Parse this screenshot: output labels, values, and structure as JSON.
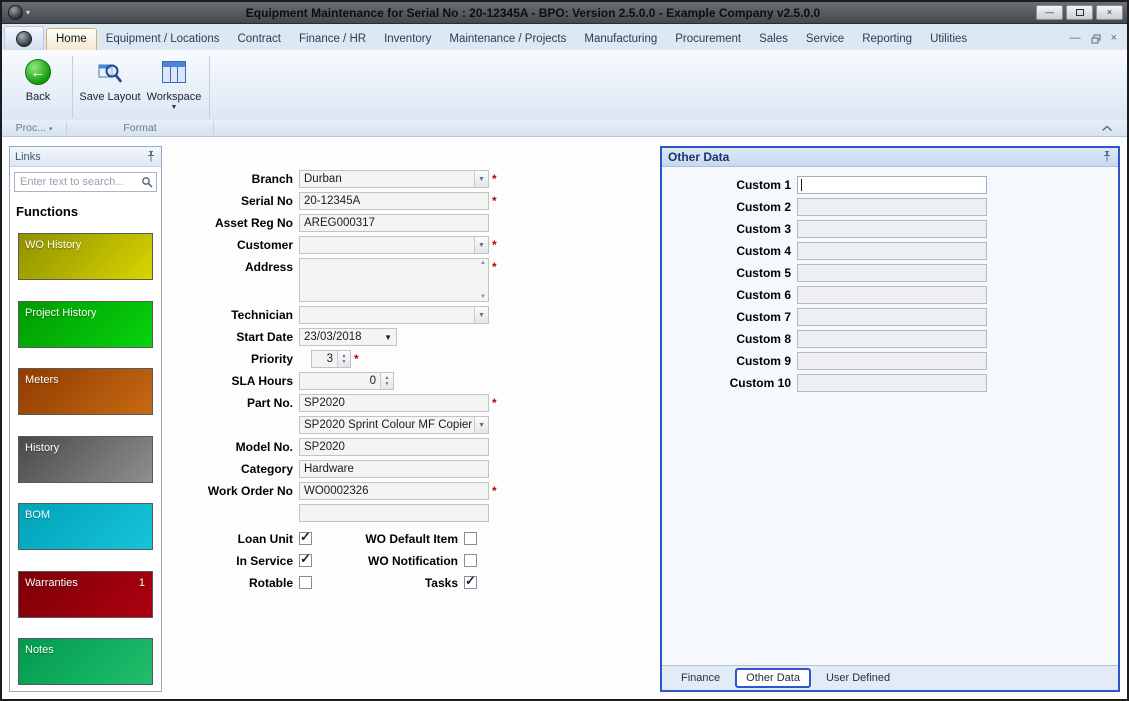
{
  "accent": {
    "highlight_blue": "#2f55c8",
    "required_red": "#c00000"
  },
  "icons": {
    "chevron_down": "▼",
    "chevron_up": "▲",
    "small_caret": "▾",
    "minimize": "—",
    "close": "×",
    "back_arrow": "←"
  },
  "titlebar": {
    "title": "Equipment Maintenance for Serial No : 20-12345A - BPO: Version 2.5.0.0 - Example Company v2.5.0.0"
  },
  "ribbon": {
    "tabs": [
      {
        "label": "Home"
      },
      {
        "label": "Equipment / Locations"
      },
      {
        "label": "Contract"
      },
      {
        "label": "Finance / HR"
      },
      {
        "label": "Inventory"
      },
      {
        "label": "Maintenance / Projects"
      },
      {
        "label": "Manufacturing"
      },
      {
        "label": "Procurement"
      },
      {
        "label": "Sales"
      },
      {
        "label": "Service"
      },
      {
        "label": "Reporting"
      },
      {
        "label": "Utilities"
      }
    ],
    "back_label": "Back",
    "save_layout_label": "Save Layout",
    "workspace_label": "Workspace",
    "group_process": "Proc...",
    "group_format": "Format"
  },
  "links_panel": {
    "title": "Links",
    "search_placeholder": "Enter text to search...",
    "heading": "Functions",
    "tiles": [
      {
        "label": "WO History",
        "color1": "#8f9000",
        "color2": "#d9d500",
        "badge": ""
      },
      {
        "label": "Project History",
        "color1": "#009b00",
        "color2": "#06d40e",
        "badge": ""
      },
      {
        "label": "Meters",
        "color1": "#8f3c00",
        "color2": "#c86a14",
        "badge": ""
      },
      {
        "label": "History",
        "color1": "#4a4a4a",
        "color2": "#8f8f8f",
        "badge": ""
      },
      {
        "label": "BOM",
        "color1": "#00a2ba",
        "color2": "#17c4d8",
        "badge": ""
      },
      {
        "label": "Warranties",
        "color1": "#7c0006",
        "color2": "#ae0010",
        "badge": "1"
      },
      {
        "label": "Notes",
        "color1": "#009a4e",
        "color2": "#22bf6e",
        "badge": ""
      }
    ]
  },
  "form": {
    "required_marker": "*",
    "rows": [
      {
        "label": "Branch",
        "value": "Durban"
      },
      {
        "label": "Serial No",
        "value": "20-12345A"
      },
      {
        "label": "Asset Reg No",
        "value": "AREG000317"
      },
      {
        "label": "Customer",
        "value": ""
      },
      {
        "label": "Address",
        "value": ""
      },
      {
        "label": "Technician",
        "value": ""
      },
      {
        "label": "Start Date",
        "value": "23/03/2018"
      },
      {
        "label": "Priority",
        "value": "3"
      },
      {
        "label": "SLA Hours",
        "value": "0"
      },
      {
        "label": "Part No.",
        "value": "SP2020"
      },
      {
        "label": "",
        "value": "SP2020 Sprint Colour MF Copier"
      },
      {
        "label": "Model No.",
        "value": "SP2020"
      },
      {
        "label": "Category",
        "value": "Hardware"
      },
      {
        "label": "Work Order No",
        "value": "WO0002326"
      },
      {
        "label": "",
        "value": ""
      }
    ],
    "checkboxes": [
      {
        "label": "Loan Unit",
        "checked": true,
        "mark": "✓"
      },
      {
        "label": "WO Default Item",
        "checked": false,
        "mark": ""
      },
      {
        "label": "In Service",
        "checked": true,
        "mark": "✓"
      },
      {
        "label": "WO Notification",
        "checked": false,
        "mark": ""
      },
      {
        "label": "Rotable",
        "checked": false,
        "mark": ""
      },
      {
        "label": "Tasks",
        "checked": true,
        "mark": "✓"
      }
    ]
  },
  "other_data_panel": {
    "title": "Other Data",
    "fields": [
      {
        "label": "Custom 1",
        "value": ""
      },
      {
        "label": "Custom 2",
        "value": ""
      },
      {
        "label": "Custom 3",
        "value": ""
      },
      {
        "label": "Custom 4",
        "value": ""
      },
      {
        "label": "Custom 5",
        "value": ""
      },
      {
        "label": "Custom 6",
        "value": ""
      },
      {
        "label": "Custom 7",
        "value": ""
      },
      {
        "label": "Custom 8",
        "value": ""
      },
      {
        "label": "Custom 9",
        "value": ""
      },
      {
        "label": "Custom 10",
        "value": ""
      }
    ],
    "tabs": [
      {
        "label": "Finance",
        "active": false
      },
      {
        "label": "Other Data",
        "active": true
      },
      {
        "label": "User Defined",
        "active": false
      }
    ]
  }
}
